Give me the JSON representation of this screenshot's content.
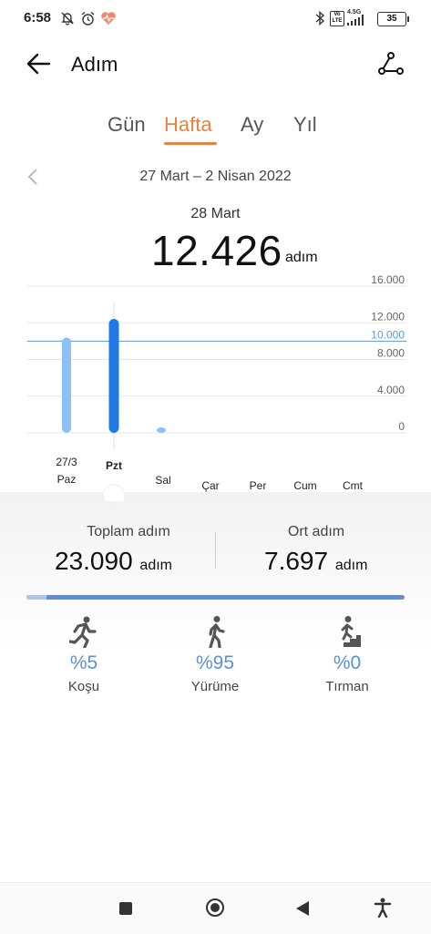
{
  "status": {
    "time": "6:58",
    "network": "4.5G",
    "volte": "Vo LTE",
    "battery": "35",
    "icons": [
      "bell-off-icon",
      "alarm-icon",
      "health-heart-icon",
      "bluetooth-icon",
      "signal-icon"
    ]
  },
  "header": {
    "title": "Adım",
    "back_icon": "back-arrow-icon",
    "share_icon": "share-nodes-icon"
  },
  "tabs": [
    {
      "label": "Gün",
      "active": false
    },
    {
      "label": "Hafta",
      "active": true
    },
    {
      "label": "Ay",
      "active": false
    },
    {
      "label": "Yıl",
      "active": false
    }
  ],
  "period": {
    "range": "27 Mart – 2 Nisan 2022",
    "selected_day": "28 Mart",
    "selected_steps": "12.426",
    "unit": "adım"
  },
  "chart_data": {
    "type": "bar",
    "categories": [
      {
        "top": "27/3",
        "bottom": "Paz"
      },
      {
        "top": "",
        "bottom": "Pzt"
      },
      {
        "top": "",
        "bottom": "Sal"
      },
      {
        "top": "",
        "bottom": "Çar"
      },
      {
        "top": "",
        "bottom": "Per"
      },
      {
        "top": "",
        "bottom": "Cum"
      },
      {
        "top": "",
        "bottom": "Cmt"
      }
    ],
    "values": [
      10400,
      12426,
      260,
      0,
      0,
      0,
      0
    ],
    "selected_index": 1,
    "y_ticks": [
      "16.000",
      "12.000",
      "8.000",
      "4.000",
      "0"
    ],
    "y_tick_values": [
      16000,
      12000,
      8000,
      4000,
      0
    ],
    "ylim": [
      0,
      16000
    ],
    "goal_line": {
      "value": 10000,
      "label": "10.000",
      "color": "#5b9bd5"
    },
    "colors": {
      "bar": "#8cc1f7",
      "selected_bar": "#1f7ae6"
    }
  },
  "summary": {
    "total_label": "Toplam adım",
    "total_value": "23.090",
    "avg_label": "Ort adım",
    "avg_value": "7.697",
    "unit": "adım"
  },
  "activities": [
    {
      "icon": "running-icon",
      "percent": "%5",
      "label": "Koşu"
    },
    {
      "icon": "walking-icon",
      "percent": "%95",
      "label": "Yürüme"
    },
    {
      "icon": "climbing-icon",
      "percent": "%0",
      "label": "Tırman"
    }
  ],
  "navbar": {
    "icons": [
      "recent-apps-icon",
      "home-icon",
      "back-triangle-icon",
      "accessibility-icon"
    ]
  }
}
